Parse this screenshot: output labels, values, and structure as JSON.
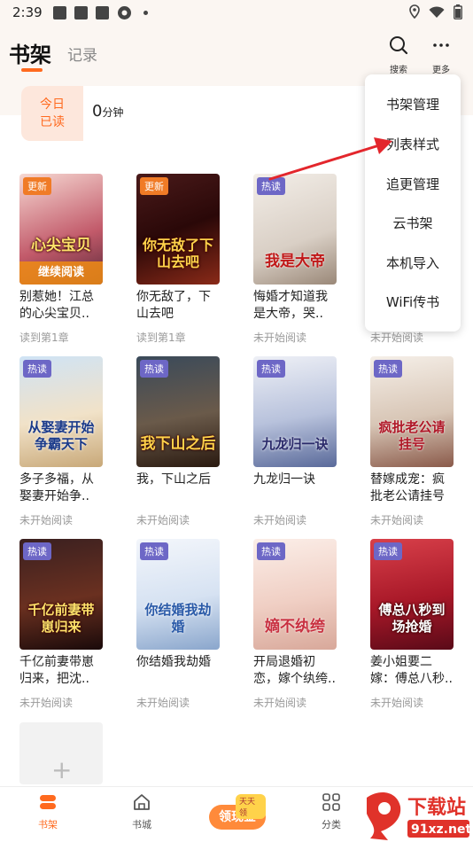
{
  "status": {
    "time": "2:39"
  },
  "header": {
    "tab_shelf": "书架",
    "tab_record": "记录",
    "search_label": "搜索",
    "more_label": "更多"
  },
  "today": {
    "badge_line1": "今日",
    "badge_line2": "已读",
    "minutes": "0",
    "unit": "分钟"
  },
  "books": [
    {
      "name": "别惹她！江总的心尖宝贝..",
      "progress": "读到第1章",
      "tag": "更新",
      "cover_title": "心尖宝贝",
      "continue": "继续阅读"
    },
    {
      "name": "你无敌了，下山去吧",
      "progress": "读到第1章",
      "tag": "更新",
      "cover_title": "你无敌了下山去吧"
    },
    {
      "name": "悔婚才知道我是大帝，哭..",
      "progress": "未开始阅读",
      "tag": "热读",
      "cover_title": "我是大帝"
    },
    {
      "name": "",
      "progress": "未开始阅读",
      "tag": "",
      "cover_title": ""
    },
    {
      "name": "多子多福，从娶妻开始争..",
      "progress": "未开始阅读",
      "tag": "热读",
      "cover_title": "从娶妻开始争霸天下"
    },
    {
      "name": "我，下山之后",
      "progress": "未开始阅读",
      "tag": "热读",
      "cover_title": "我下山之后"
    },
    {
      "name": "九龙归一诀",
      "progress": "未开始阅读",
      "tag": "热读",
      "cover_title": "九龙归一诀"
    },
    {
      "name": "替嫁成宠：疯批老公请挂号",
      "progress": "未开始阅读",
      "tag": "热读",
      "cover_title": "疯批老公请挂号"
    },
    {
      "name": "千亿前妻带崽归来，把沈..",
      "progress": "未开始阅读",
      "tag": "热读",
      "cover_title": "千亿前妻带崽归来"
    },
    {
      "name": "你结婚我劫婚",
      "progress": "未开始阅读",
      "tag": "热读",
      "cover_title": "你结婚我劫婚"
    },
    {
      "name": "开局退婚初恋，嫁个纨绔..",
      "progress": "未开始阅读",
      "tag": "热读",
      "cover_title": "嫡不纨绔"
    },
    {
      "name": "姜小姐要二嫁：傅总八秒..",
      "progress": "未开始阅读",
      "tag": "热读",
      "cover_title": "傅总八秒到场抢婚"
    }
  ],
  "menu": {
    "items": [
      "书架管理",
      "列表样式",
      "追更管理",
      "云书架",
      "本机导入",
      "WiFi传书"
    ]
  },
  "bottom_nav": {
    "shelf": "书架",
    "store": "书城",
    "coin": "领现金",
    "coin_mini": "天天领",
    "category": "分类"
  },
  "watermark": {
    "text": "下载站",
    "domain": "91xz.net"
  },
  "colors": {
    "accent": "#ff6a1f",
    "hot_tag": "#6d67c6",
    "update_tag": "#f07b26",
    "arrow": "#e3262c"
  }
}
